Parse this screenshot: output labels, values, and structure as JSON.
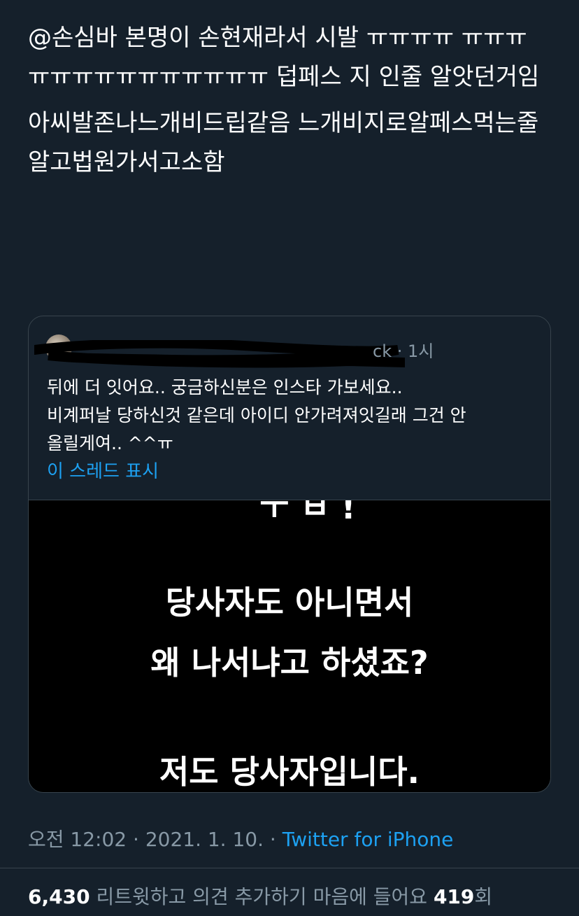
{
  "tweet": {
    "lines": [
      "@손심바 본명이 손현재라서 시발 ㅠㅠㅠㅠ ㅠㅠㅠㅠㅠㅠㅠㅠㅠㅠㅠㅠㅠㅠ 덥페스 지 인줄 알앗던거임",
      "아씨발존나느개비드립같음 느개비지로알페스먹는줄알고법원가서고소함"
    ]
  },
  "quote": {
    "time": "ck · 1시",
    "body_lines": [
      "뒤에 더 잇어요.. 궁금하신분은 인스타 가보세요..",
      "비계퍼날 당하신것 같은데 아이디 안가려져잇길래 그건 안",
      "올릴게여.. ^^ㅠ"
    ],
    "show_thread": "이 스레드 표시",
    "media": {
      "fragment": "ㅜ ㅂ !",
      "lines": [
        "당사자도 아니면서",
        "왜 나서냐고 하셨죠?",
        "저도 당사자입니다."
      ]
    }
  },
  "meta": {
    "datetime": "오전 12:02 · 2021. 1. 10. · ",
    "source": "Twitter for iPhone"
  },
  "stats": {
    "retweets": "6,430",
    "retweets_label": "리트윗하고 의견 추가하기",
    "likes_label": "마음에 들어요",
    "likes": "419",
    "likes_suffix": "회"
  },
  "colors": {
    "background": "#15202b",
    "accent": "#1da1f2",
    "secondary_text": "#8899a6",
    "border": "#38444d"
  }
}
